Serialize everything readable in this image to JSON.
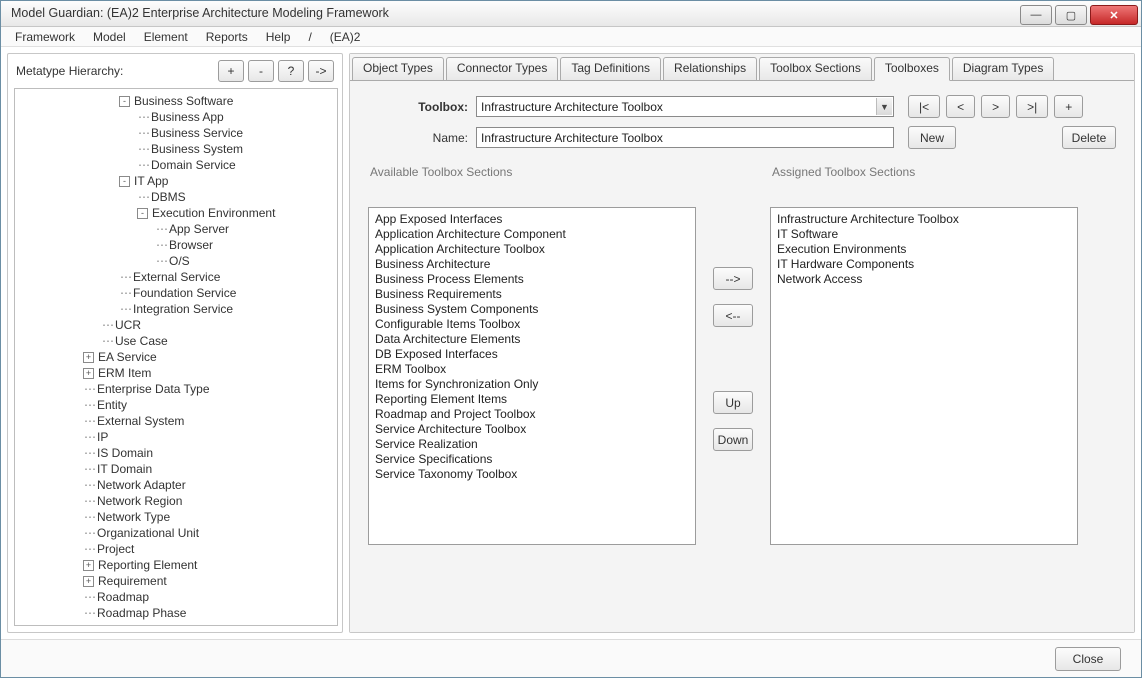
{
  "window": {
    "title": "Model Guardian: (EA)2 Enterprise Architecture Modeling Framework"
  },
  "menu": [
    "Framework",
    "Model",
    "Element",
    "Reports",
    "Help",
    "/",
    "(EA)2"
  ],
  "left": {
    "heading": "Metatype Hierarchy:",
    "buttons": {
      "add": "+",
      "remove": "-",
      "help": "?",
      "go": "->"
    },
    "tree": [
      {
        "d": 3,
        "e": "-",
        "t": "Business Software"
      },
      {
        "d": 4,
        "t": "Business App"
      },
      {
        "d": 4,
        "t": "Business Service"
      },
      {
        "d": 4,
        "t": "Business System"
      },
      {
        "d": 4,
        "t": "Domain Service"
      },
      {
        "d": 3,
        "e": "-",
        "t": "IT App"
      },
      {
        "d": 4,
        "t": "DBMS"
      },
      {
        "d": 4,
        "e": "-",
        "t": "Execution Environment"
      },
      {
        "d": 5,
        "t": "App Server"
      },
      {
        "d": 5,
        "t": "Browser"
      },
      {
        "d": 5,
        "t": "O/S"
      },
      {
        "d": 3,
        "t": "External Service"
      },
      {
        "d": 3,
        "t": "Foundation Service"
      },
      {
        "d": 3,
        "t": "Integration Service"
      },
      {
        "d": 2,
        "t": "UCR"
      },
      {
        "d": 2,
        "t": "Use Case"
      },
      {
        "d": 1,
        "e": "+",
        "t": "EA Service"
      },
      {
        "d": 1,
        "e": "+",
        "t": "ERM Item"
      },
      {
        "d": 1,
        "t": "Enterprise Data Type"
      },
      {
        "d": 1,
        "t": "Entity"
      },
      {
        "d": 1,
        "t": "External System"
      },
      {
        "d": 1,
        "t": "IP"
      },
      {
        "d": 1,
        "t": "IS Domain"
      },
      {
        "d": 1,
        "t": "IT Domain"
      },
      {
        "d": 1,
        "t": "Network Adapter"
      },
      {
        "d": 1,
        "t": "Network Region"
      },
      {
        "d": 1,
        "t": "Network Type"
      },
      {
        "d": 1,
        "t": "Organizational Unit"
      },
      {
        "d": 1,
        "t": "Project"
      },
      {
        "d": 1,
        "e": "+",
        "t": "Reporting Element"
      },
      {
        "d": 1,
        "e": "+",
        "t": "Requirement"
      },
      {
        "d": 1,
        "t": "Roadmap"
      },
      {
        "d": 1,
        "t": "Roadmap Phase"
      }
    ]
  },
  "tabs": [
    "Object Types",
    "Connector Types",
    "Tag Definitions",
    "Relationships",
    "Toolbox Sections",
    "Toolboxes",
    "Diagram Types"
  ],
  "active_tab": "Toolboxes",
  "form": {
    "toolbox_label": "Toolbox:",
    "toolbox_value": "Infrastructure Architecture Toolbox",
    "name_label": "Name:",
    "name_value": "Infrastructure Architecture Toolbox",
    "nav": {
      "first": "|<",
      "prev": "<",
      "next": ">",
      "last": ">|",
      "add": "+"
    },
    "new_btn": "New",
    "delete_btn": "Delete"
  },
  "available": {
    "title": "Available Toolbox Sections",
    "items": [
      "App Exposed Interfaces",
      "Application Architecture Component",
      "Application Architecture Toolbox",
      "Business Architecture",
      "Business Process Elements",
      "Business Requirements",
      "Business System Components",
      "Configurable Items Toolbox",
      "Data Architecture Elements",
      "DB Exposed Interfaces",
      "ERM Toolbox",
      "Items for Synchronization Only",
      "Reporting Element Items",
      "Roadmap and Project Toolbox",
      "Service Architecture Toolbox",
      "Service Realization",
      "Service Specifications",
      "Service Taxonomy Toolbox"
    ]
  },
  "assigned": {
    "title": "Assigned Toolbox Sections",
    "items": [
      "Infrastructure Architecture Toolbox",
      "IT Software",
      "Execution Environments",
      "IT Hardware Components",
      "Network Access"
    ]
  },
  "mover": {
    "right": "-->",
    "left": "<--",
    "up": "Up",
    "down": "Down"
  },
  "footer": {
    "close": "Close"
  }
}
